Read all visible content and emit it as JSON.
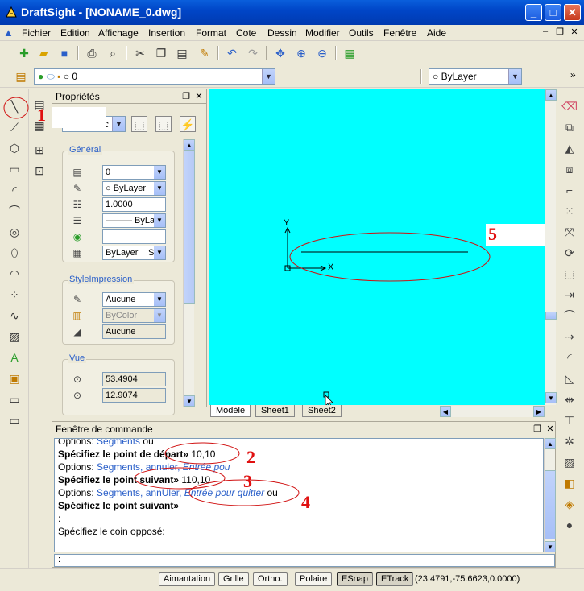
{
  "window": {
    "title": "DraftSight - [NONAME_0.dwg]",
    "minimize": "_",
    "maximize": "□",
    "close": "✕"
  },
  "menu": [
    "Fichier",
    "Edition",
    "Affichage",
    "Insertion",
    "Format",
    "Cote",
    "Dessin",
    "Modifier",
    "Outils",
    "Fenêtre",
    "Aide"
  ],
  "mdi": {
    "min": "–",
    "restore": "❐",
    "close": "✕"
  },
  "layer_bar": {
    "layer_value": "0",
    "color_value": "ByLayer",
    "more": "»"
  },
  "properties": {
    "title": "Propriétés",
    "selector_value": "c",
    "general": {
      "title": "Général",
      "layer": "0",
      "color": "ByLayer",
      "linescale": "1.0000",
      "linetype": "——— ByLa",
      "hyperlink": "",
      "lineweight": "ByLayer",
      "lineweight_suffix": "S"
    },
    "print_style": {
      "title": "StyleImpression",
      "style": "Aucune",
      "by_color": "ByColor",
      "table": "Aucune"
    },
    "view": {
      "title": "Vue",
      "center_x": "53.4904",
      "center_y": "12.9074"
    }
  },
  "canvas": {
    "axis_y": "Y",
    "axis_x": "X",
    "tabs": [
      "Modèle",
      "Sheet1",
      "Sheet2"
    ],
    "active_tab": 0
  },
  "command_window": {
    "title": "Fenêtre de commande",
    "lines": [
      {
        "prefix": "Options: ",
        "link": "Segments",
        "suffix": " ou"
      },
      {
        "bold": "Spécifiez le point de départ»",
        "value": " 10,10"
      },
      {
        "prefix": "Options: ",
        "link": "Segments, annuler, ",
        "italic": "Entrée pou"
      },
      {
        "bold": "Spécifiez le point suivant»",
        "value": " 110,10"
      },
      {
        "prefix": "Options: ",
        "link": "Segments, annUler, ",
        "italic": "Entrée pour quitter",
        "suffix": " ou"
      },
      {
        "bold": "Spécifiez le point suivant»"
      },
      {
        "plain": ":"
      },
      {
        "plain": "Spécifiez le coin opposé:"
      }
    ],
    "prompt": ":"
  },
  "status_bar": {
    "buttons": [
      "Aimantation",
      "Grille",
      "Ortho.",
      "Polaire",
      "ESnap",
      "ETrack"
    ],
    "active": [
      "ESnap",
      "ETrack"
    ],
    "coordinates": "(23.4791,-75.6623,0.0000)"
  },
  "annotations": [
    "1",
    "2",
    "3",
    "4",
    "5"
  ],
  "colors": {
    "canvas": "#00ffff",
    "annotation": "#e01010",
    "titlebar": "#0046c8",
    "link": "#2a5fc9"
  }
}
